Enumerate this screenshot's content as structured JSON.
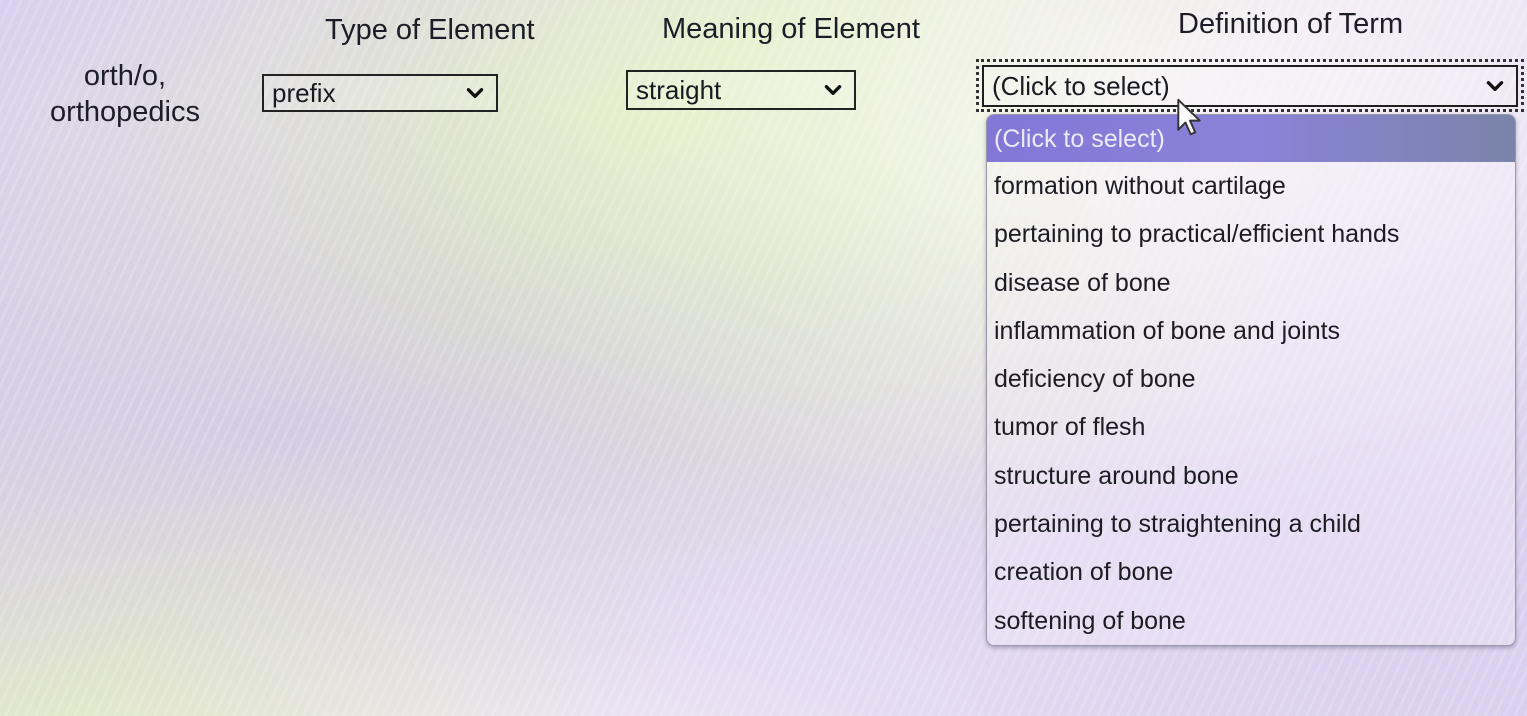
{
  "headers": {
    "type": "Type of Element",
    "meaning": "Meaning of Element",
    "definition": "Definition of Term"
  },
  "term": {
    "line1": "orth/o,",
    "line2": "orthopedics"
  },
  "type_select": {
    "value": "prefix",
    "icon": "chevron-down-icon"
  },
  "meaning_select": {
    "value": "straight",
    "icon": "chevron-down-icon"
  },
  "definition_select": {
    "value": "(Click to select)",
    "icon": "chevron-down-icon",
    "expanded": true,
    "highlighted_index": 0,
    "options": [
      "(Click to select)",
      "formation without cartilage",
      "pertaining to practical/efficient hands",
      "disease of bone",
      "inflammation of bone and joints",
      "deficiency of bone",
      "tumor of flesh",
      "structure around bone",
      "pertaining to straightening a child",
      "creation of bone",
      "softening of bone"
    ]
  },
  "colors": {
    "highlight": "#8377d6",
    "text": "#1d1d28"
  }
}
